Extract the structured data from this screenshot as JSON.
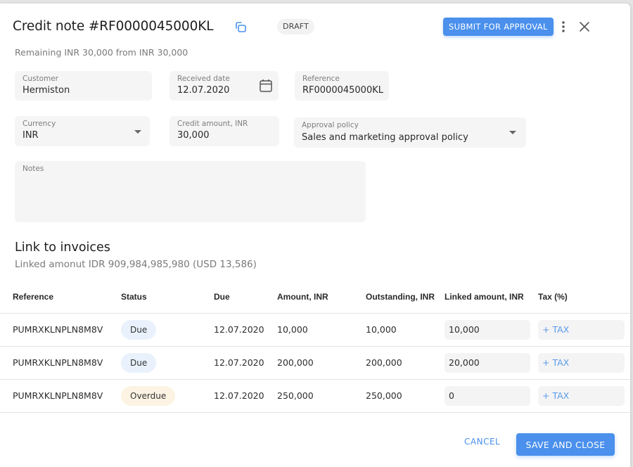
{
  "header": {
    "title": "Credit note #RF0000045000KL",
    "status_badge": "DRAFT",
    "submit_label": "SUBMIT FOR APPROVAL",
    "icons": {
      "copy": "copy-icon",
      "more": "more-vertical-icon",
      "close": "close-icon"
    }
  },
  "remaining_text": "Remaining INR 30,000 from INR 30,000",
  "form": {
    "customer": {
      "label": "Customer",
      "value": "Hermiston"
    },
    "received_date": {
      "label": "Received date",
      "value": "12.07.2020",
      "icon": "calendar-icon"
    },
    "reference": {
      "label": "Reference",
      "value": "RF0000045000KL"
    },
    "currency": {
      "label": "Currency",
      "value": "INR",
      "icon": "chevron-down-icon"
    },
    "credit_amount": {
      "label": "Credit amount, INR",
      "value": "30,000"
    },
    "approval_policy": {
      "label": "Approval policy",
      "value": "Sales and marketing approval policy",
      "icon": "chevron-down-icon"
    },
    "notes": {
      "label": "Notes",
      "value": ""
    }
  },
  "link_section": {
    "title": "Link to invoices",
    "linked_amount": "Linked amonut IDR 909,984,985,980  (USD 13,586)"
  },
  "table": {
    "columns": [
      "Reference",
      "Status",
      "Due",
      "Amount, INR",
      "Outstanding, INR",
      "Linked amount, INR",
      "Tax (%)"
    ],
    "rows": [
      {
        "reference": "PUMRXKLNPLN8M8V",
        "status": "Due",
        "due": "12.07.2020",
        "amount": "10,000",
        "outstanding": "10,000",
        "linked": "10,000",
        "tax": "+ TAX"
      },
      {
        "reference": "PUMRXKLNPLN8M8V",
        "status": "Due",
        "due": "12.07.2020",
        "amount": "200,000",
        "outstanding": "200,000",
        "linked": "20,000",
        "tax": "+ TAX"
      },
      {
        "reference": "PUMRXKLNPLN8M8V",
        "status": "Overdue",
        "due": "12.07.2020",
        "amount": "250,000",
        "outstanding": "250,000",
        "linked": "0",
        "tax": "+ TAX"
      }
    ]
  },
  "footer": {
    "cancel_label": "CANCEL",
    "save_label": "SAVE AND CLOSE"
  },
  "colors": {
    "accent": "#4a90ec",
    "due_pill": "#e9f2fc",
    "overdue_pill": "#fdf3e3",
    "field_bg": "#f5f5f6"
  }
}
